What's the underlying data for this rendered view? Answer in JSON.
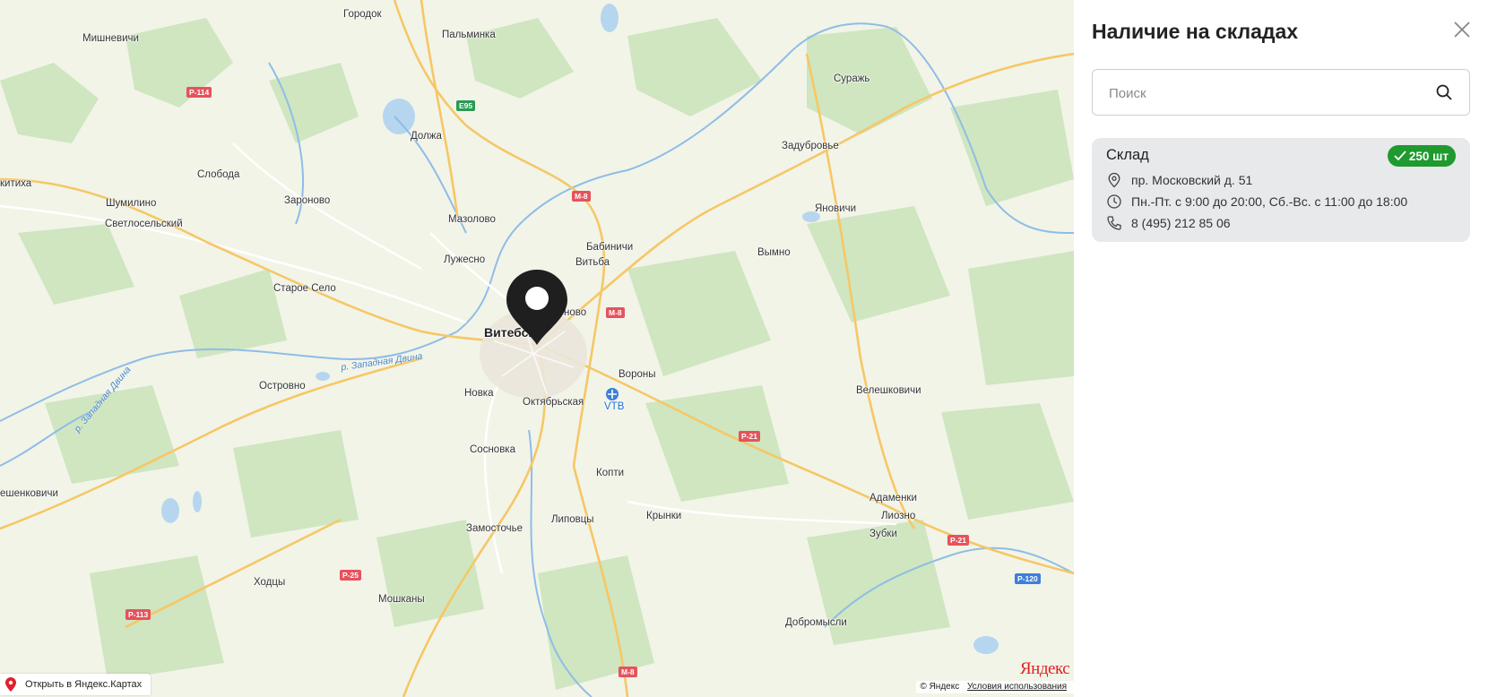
{
  "map": {
    "places": [
      {
        "name": "Городок",
        "city": false
      },
      {
        "name": "Мишневичи",
        "city": false
      },
      {
        "name": "Пальминка",
        "city": false
      },
      {
        "name": "Суражь",
        "city": false
      },
      {
        "name": "Должа",
        "city": false
      },
      {
        "name": "Задубровье",
        "city": false
      },
      {
        "name": "Слобода",
        "city": false
      },
      {
        "name": "Заронoво",
        "city": false
      },
      {
        "name": "Шумилино",
        "city": false
      },
      {
        "name": "Светлосельский",
        "city": false
      },
      {
        "name": "Мазолово",
        "city": false
      },
      {
        "name": "Бабиничи",
        "city": false
      },
      {
        "name": "Яновичи",
        "city": false
      },
      {
        "name": "Лужесно",
        "city": false
      },
      {
        "name": "Витьба",
        "city": false
      },
      {
        "name": "Вымно",
        "city": false
      },
      {
        "name": "Старое Село",
        "city": false
      },
      {
        "name": "Витебск",
        "city": true
      },
      {
        "name": "Вороны",
        "city": false
      },
      {
        "name": "Островно",
        "city": false
      },
      {
        "name": "Новка",
        "city": false
      },
      {
        "name": "Октябрьская",
        "city": false
      },
      {
        "name": "Велешковичи",
        "city": false
      },
      {
        "name": "Сосновка",
        "city": false
      },
      {
        "name": "Копти",
        "city": false
      },
      {
        "name": "Адаменки",
        "city": false
      },
      {
        "name": "Лиозно",
        "city": false
      },
      {
        "name": "Замосточье",
        "city": false
      },
      {
        "name": "Липовцы",
        "city": false
      },
      {
        "name": "Крынки",
        "city": false
      },
      {
        "name": "Зубки",
        "city": false
      },
      {
        "name": "Ходцы",
        "city": false
      },
      {
        "name": "Мошканы",
        "city": false
      },
      {
        "name": "Добромысли",
        "city": false
      },
      {
        "name": "китиха",
        "city": false
      },
      {
        "name": "ешенковичи",
        "city": false
      },
      {
        "name": "ново",
        "city": false
      }
    ],
    "airport": "VTB",
    "rivers": [
      "р. Западная Двина",
      "р. Западная Двина"
    ],
    "shields": [
      "Р-114",
      "Е95",
      "М-8",
      "М-8",
      "Р-21",
      "Р-21",
      "Р-120",
      "Р-25",
      "Р-113",
      "М-8"
    ],
    "open_link": "Открыть в Яндекс.Картах",
    "logo": "Яндекс",
    "copyright": "© Яндекс",
    "terms": "Условия использования"
  },
  "panel": {
    "title": "Наличие на складах",
    "search_placeholder": "Поиск",
    "warehouses": [
      {
        "name": "Склад",
        "stock": "250 шт",
        "address": "пр. Московский д. 51",
        "hours": "Пн.-Пт. с 9:00 до 20:00, Сб.-Вс. с 11:00 до 18:00",
        "phone": "8 (495) 212 85 06"
      }
    ]
  },
  "colors": {
    "stock_badge": "#1e9a2e",
    "card_bg": "#e7e9ea",
    "pin": "#1f1f1f",
    "road_major": "#f6c766",
    "forest": "#cfe6c0",
    "water": "#b6d6ef"
  }
}
